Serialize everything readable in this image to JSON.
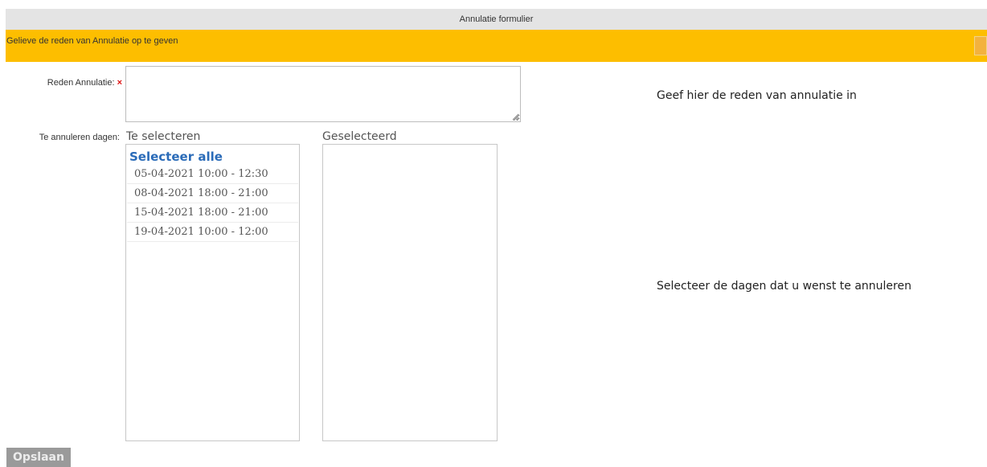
{
  "window": {
    "title": "Annulatie formulier"
  },
  "banner": {
    "message": "Gelieve de reden van Annulatie op te geven"
  },
  "form": {
    "reason_label": "Reden Annulatie:",
    "required_mark": "×",
    "reason_value": "",
    "days_label": "Te annuleren dagen:"
  },
  "available": {
    "heading": "Te selecteren",
    "select_all": "Selecteer alle",
    "items": [
      "05-04-2021 10:00 - 12:30",
      "08-04-2021 18:00 - 21:00",
      "15-04-2021 18:00 - 21:00",
      "19-04-2021 10:00 - 12:00"
    ]
  },
  "selected": {
    "heading": "Geselecteerd",
    "items": []
  },
  "hints": {
    "reason": "Geef hier de reden van annulatie in",
    "days": "Selecteer de dagen dat u wenst te annuleren"
  },
  "actions": {
    "save": "Opslaan"
  },
  "colors": {
    "banner": "#fdbe00",
    "titlebar": "#e4e4e4",
    "link": "#2a6bb8",
    "required": "#dd1111",
    "button": "#9a9a9a"
  }
}
